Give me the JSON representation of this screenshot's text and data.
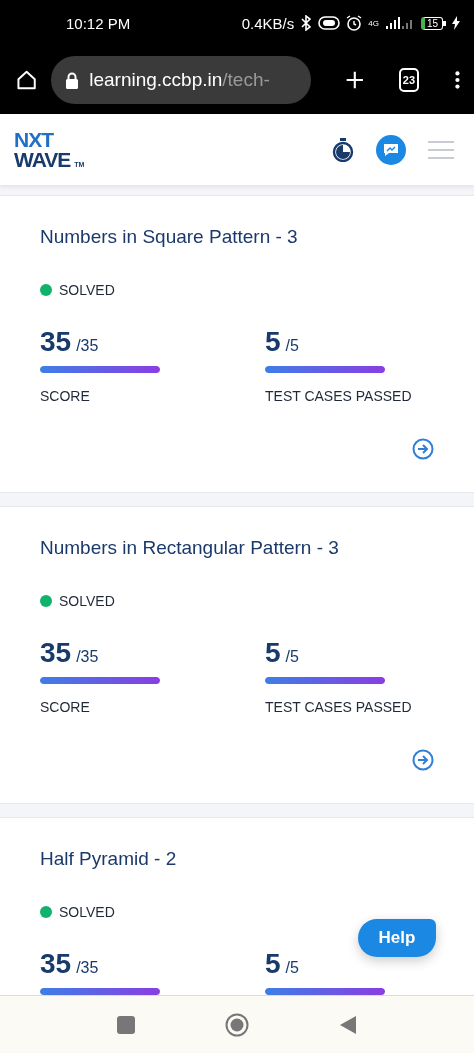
{
  "status_bar": {
    "time": "10:12 PM",
    "speed": "0.4KB/s",
    "network": "4G",
    "battery": "15"
  },
  "browser": {
    "url_host": "learning.ccbp.in",
    "url_path": "/tech-",
    "tab_count": "23"
  },
  "header": {
    "logo_top": "NXT",
    "logo_bottom": "WAVE",
    "logo_mark": "TM"
  },
  "cards": [
    {
      "title": "Numbers in Square Pattern - 3",
      "status": {
        "label": "SOLVED",
        "solved": true
      },
      "score": {
        "value": "35",
        "total": "/35",
        "level": 1,
        "label": "SCORE"
      },
      "tests": {
        "value": "5",
        "total": "/5",
        "level": 1,
        "label": "TEST CASES PASSED"
      },
      "open_arrow": true
    },
    {
      "title": "Numbers in Rectangular Pattern - 3",
      "status": {
        "label": "SOLVED",
        "solved": true
      },
      "score": {
        "value": "35",
        "total": "/35",
        "level": 1,
        "label": "SCORE"
      },
      "tests": {
        "value": "5",
        "total": "/5",
        "level": 1,
        "label": "TEST CASES PASSED"
      },
      "open_arrow": true
    },
    {
      "title": "Half Pyramid - 2",
      "status": {
        "label": "SOLVED",
        "solved": true
      },
      "score": {
        "value": "35",
        "total": "/35",
        "level": 1
      },
      "tests": {
        "value": "5",
        "total": "/5",
        "level": 1
      }
    }
  ],
  "help_button": "Help"
}
